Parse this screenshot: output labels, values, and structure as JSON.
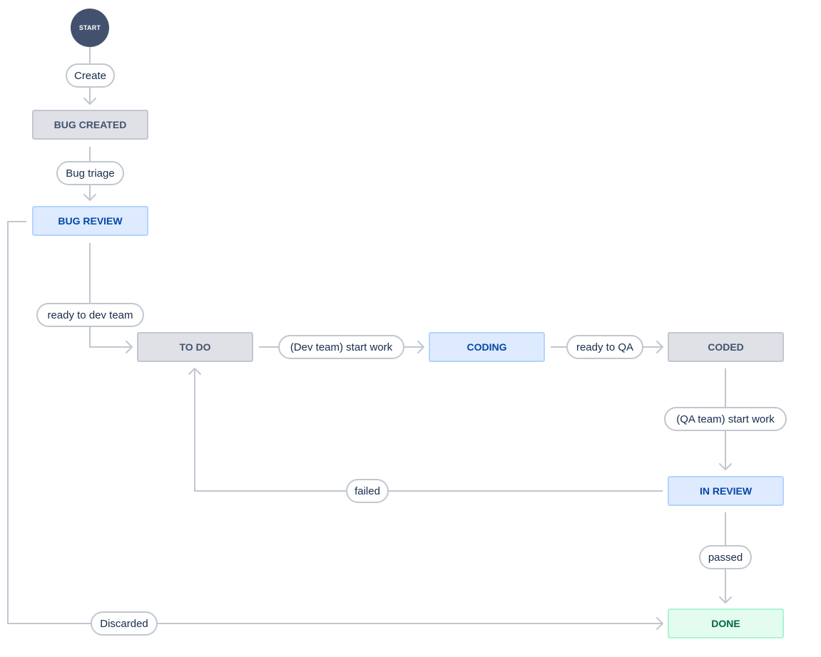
{
  "start_node": {
    "label": "START",
    "color": "#42526e"
  },
  "statuses": {
    "bug_created": {
      "label": "BUG CREATED",
      "category": "todo"
    },
    "bug_review": {
      "label": "BUG REVIEW",
      "category": "inprogress"
    },
    "to_do": {
      "label": "TO DO",
      "category": "todo"
    },
    "coding": {
      "label": "CODING",
      "category": "inprogress"
    },
    "coded": {
      "label": "CODED",
      "category": "todo"
    },
    "in_review": {
      "label": "IN REVIEW",
      "category": "inprogress"
    },
    "done": {
      "label": "DONE",
      "category": "done"
    }
  },
  "transitions": {
    "create": "Create",
    "bug_triage": "Bug triage",
    "ready_to_dev_team": "ready to dev team",
    "dev_start_work": "(Dev team) start work",
    "ready_to_qa": "ready to QA",
    "qa_start_work": "(QA team) start work",
    "failed": "failed",
    "passed": "passed",
    "discarded": "Discarded"
  },
  "colors": {
    "connector": "#c1c7d0",
    "todo_bg": "#dfe1e6",
    "todo_text": "#42526e",
    "inprogress_bg": "#deebff",
    "inprogress_text": "#0747a6",
    "done_bg": "#e3fcef",
    "done_text": "#006644"
  }
}
